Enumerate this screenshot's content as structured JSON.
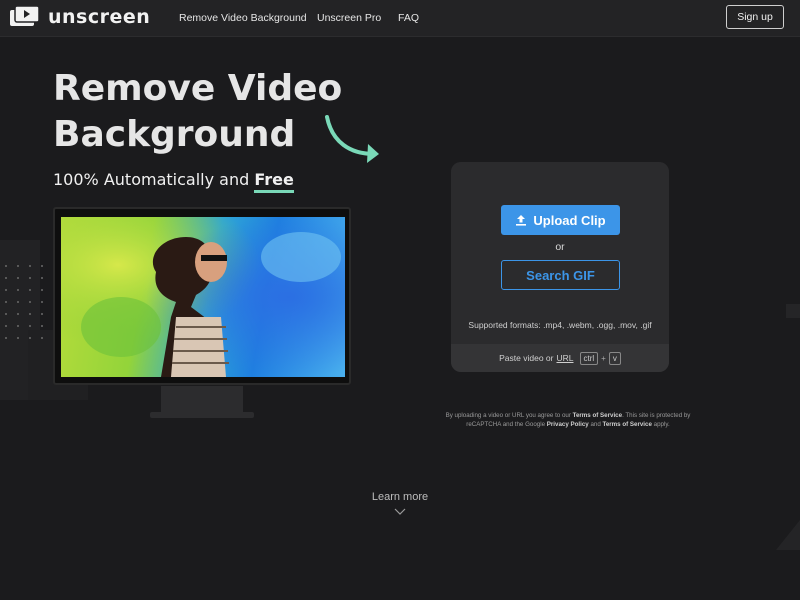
{
  "nav": {
    "brand": "unscreen",
    "links": [
      "Remove Video Background",
      "Unscreen Pro",
      "FAQ"
    ],
    "signup": "Sign up"
  },
  "hero": {
    "title": "Remove Video Background",
    "subtitle_prefix": "100% Automatically and ",
    "subtitle_emphasis": "Free"
  },
  "upload": {
    "upload_button": "Upload Clip",
    "or": "or",
    "gif_button": "Search GIF",
    "formats": "Supported formats: .mp4, .webm, .ogg, .mov, .gif",
    "paste_prefix": "Paste video or",
    "paste_url": "URL",
    "key_ctrl": "ctrl",
    "key_plus": "+",
    "key_v": "v"
  },
  "legal": {
    "t1": "By uploading a video or URL you agree to our ",
    "terms": "Terms of Service",
    "t2": ". This site is protected by reCAPTCHA and the Google ",
    "privacy": "Privacy Policy",
    "t3": " and ",
    "terms2": "Terms of Service",
    "t4": " apply."
  },
  "learn_more": "Learn more",
  "colors": {
    "accent": "#3c95e8",
    "highlight": "#7ad9b8",
    "background": "#1b1b1d"
  },
  "icons": [
    "logo-icon",
    "upload-icon",
    "curved-arrow-icon",
    "chevron-down-icon"
  ]
}
